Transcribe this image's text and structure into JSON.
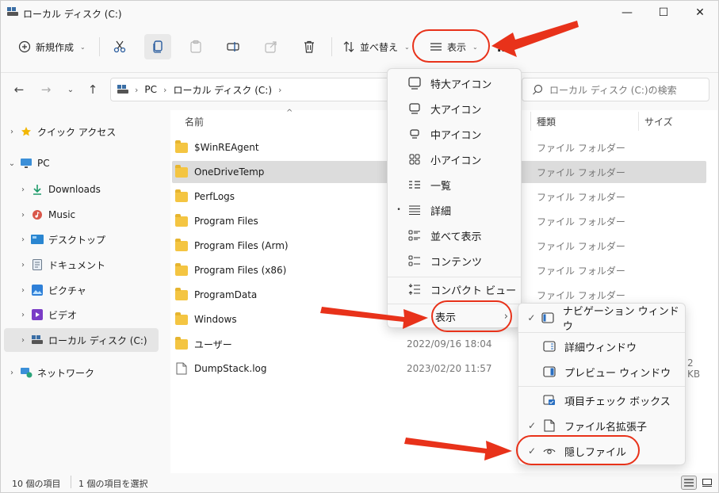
{
  "window": {
    "title": "ローカル ディスク (C:)"
  },
  "toolbar": {
    "new_label": "新規作成",
    "sort_label": "並べ替え",
    "view_label": "表示",
    "more": "…"
  },
  "address": {
    "segments": [
      "PC",
      "ローカル ディスク (C:)"
    ],
    "search_placeholder": "ローカル ディスク (C:)の検索"
  },
  "sidebar": {
    "items": [
      {
        "label": "クイック アクセス"
      },
      {
        "label": "PC"
      },
      {
        "label": "Downloads"
      },
      {
        "label": "Music"
      },
      {
        "label": "デスクトップ"
      },
      {
        "label": "ドキュメント"
      },
      {
        "label": "ピクチャ"
      },
      {
        "label": "ビデオ"
      },
      {
        "label": "ローカル ディスク (C:)"
      },
      {
        "label": "ネットワーク"
      }
    ]
  },
  "columns": {
    "name": "名前",
    "type": "種類",
    "size": "サイズ"
  },
  "files": [
    {
      "name": "$WinREAgent",
      "date": "",
      "type": "ファイル フォルダー",
      "size": ""
    },
    {
      "name": "OneDriveTemp",
      "date": "",
      "type": "ファイル フォルダー",
      "size": ""
    },
    {
      "name": "PerfLogs",
      "date": "",
      "type": "ファイル フォルダー",
      "size": ""
    },
    {
      "name": "Program Files",
      "date": "",
      "type": "ファイル フォルダー",
      "size": ""
    },
    {
      "name": "Program Files (Arm)",
      "date": "",
      "type": "ファイル フォルダー",
      "size": ""
    },
    {
      "name": "Program Files (x86)",
      "date": "",
      "type": "ファイル フォルダー",
      "size": ""
    },
    {
      "name": "ProgramData",
      "date": "",
      "type": "ファイル フォルダー",
      "size": ""
    },
    {
      "name": "Windows",
      "date": "",
      "type": "",
      "size": ""
    },
    {
      "name": "ユーザー",
      "date": "2022/09/16 18:04",
      "type": "",
      "size": ""
    },
    {
      "name": "DumpStack.log",
      "date": "2023/02/20 11:57",
      "type": "",
      "size": "2 KB"
    }
  ],
  "view_menu": {
    "items": [
      {
        "label": "特大アイコン"
      },
      {
        "label": "大アイコン"
      },
      {
        "label": "中アイコン"
      },
      {
        "label": "小アイコン"
      },
      {
        "label": "一覧"
      },
      {
        "label": "詳細"
      },
      {
        "label": "並べて表示"
      },
      {
        "label": "コンテンツ"
      },
      {
        "label": "コンパクト ビュー"
      },
      {
        "label": "表示"
      }
    ],
    "selected_bullet": "•"
  },
  "show_submenu": {
    "items": [
      {
        "label": "ナビゲーション ウィンドウ",
        "checked": true
      },
      {
        "label": "詳細ウィンドウ",
        "checked": false
      },
      {
        "label": "プレビュー ウィンドウ",
        "checked": false
      },
      {
        "label": "項目チェック ボックス",
        "checked": false
      },
      {
        "label": "ファイル名拡張子",
        "checked": true
      },
      {
        "label": "隠しファイル",
        "checked": true
      }
    ],
    "check": "✓"
  },
  "status": {
    "item_count": "10 個の項目",
    "selected": "1 個の項目を選択"
  },
  "colors": {
    "annotation": "#e8321a",
    "folder": "#f4c542",
    "accent": "#0067c0"
  }
}
